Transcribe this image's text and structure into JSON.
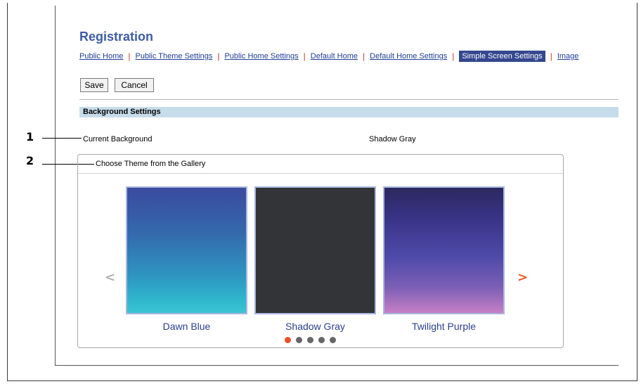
{
  "page_title": "Registration",
  "tabs": [
    {
      "label": "Public Home",
      "active": false
    },
    {
      "label": "Public Theme Settings",
      "active": false
    },
    {
      "label": "Public Home Settings",
      "active": false
    },
    {
      "label": "Default Home",
      "active": false
    },
    {
      "label": "Default Home Settings",
      "active": false
    },
    {
      "label": "Simple Screen Settings",
      "active": true
    },
    {
      "label": "Image",
      "active": false
    }
  ],
  "buttons": {
    "save": "Save",
    "cancel": "Cancel"
  },
  "section": {
    "title": "Background Settings"
  },
  "current_background": {
    "label": "Current Background",
    "value": "Shadow Gray"
  },
  "gallery": {
    "title": "Choose Theme from the Gallery",
    "prev_arrow": "<",
    "next_arrow": ">",
    "themes": [
      {
        "name": "Dawn Blue",
        "colors": [
          "#3b4aa0",
          "#3cc3d3"
        ]
      },
      {
        "name": "Shadow Gray",
        "colors": [
          "#333438",
          "#333438"
        ]
      },
      {
        "name": "Twilight Purple",
        "colors": [
          "#2c2860",
          "#c77fc5"
        ]
      }
    ],
    "pages": 5,
    "active_page": 1
  },
  "callouts": [
    "1",
    "2"
  ],
  "colors": {
    "accent": "#3d5ca6",
    "active_tab": "#34478f",
    "section_bar": "#c6dcea",
    "next_arrow": "#e85a2b",
    "active_dot": "#e8502a"
  }
}
